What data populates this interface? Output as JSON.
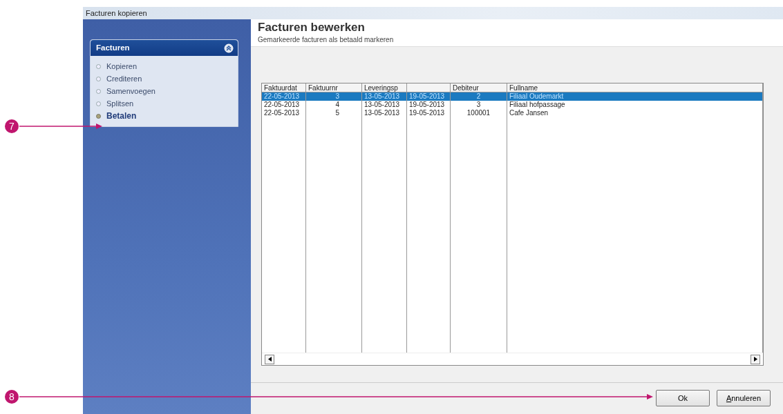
{
  "window": {
    "title": "Facturen kopieren"
  },
  "sidebar": {
    "title": "Facturen",
    "expanded": true,
    "items": [
      {
        "label": "Kopieren",
        "selected": false
      },
      {
        "label": "Crediteren",
        "selected": false
      },
      {
        "label": "Samenvoegen",
        "selected": false
      },
      {
        "label": "Splitsen",
        "selected": false
      },
      {
        "label": "Betalen",
        "selected": true
      }
    ]
  },
  "header": {
    "title": "Facturen bewerken",
    "subtitle": "Gemarkeerde facturen als betaald markeren"
  },
  "table": {
    "columns": [
      {
        "label": "Faktuurdat"
      },
      {
        "label": "Faktuurnr"
      },
      {
        "label": "Leveringsp"
      },
      {},
      {
        "label": "Debiteur"
      },
      {
        "label": "Fullname"
      }
    ],
    "rows": [
      {
        "selected": true,
        "cells": [
          "22-05-2013",
          "3",
          "13-05-2013",
          "19-05-2013",
          "2",
          "Filiaal Oudemarkt"
        ]
      },
      {
        "selected": false,
        "cells": [
          "22-05-2013",
          "4",
          "13-05-2013",
          "19-05-2013",
          "3",
          "Filiaal hofpassage"
        ]
      },
      {
        "selected": false,
        "cells": [
          "22-05-2013",
          "5",
          "13-05-2013",
          "19-05-2013",
          "100001",
          "Cafe Jansen"
        ]
      }
    ]
  },
  "buttons": [
    {
      "label": "Ok",
      "mnemonic": false
    },
    {
      "label": "Annuleren",
      "mnemonic": true
    }
  ],
  "callouts": [
    {
      "number": "7"
    },
    {
      "number": "8"
    }
  ]
}
